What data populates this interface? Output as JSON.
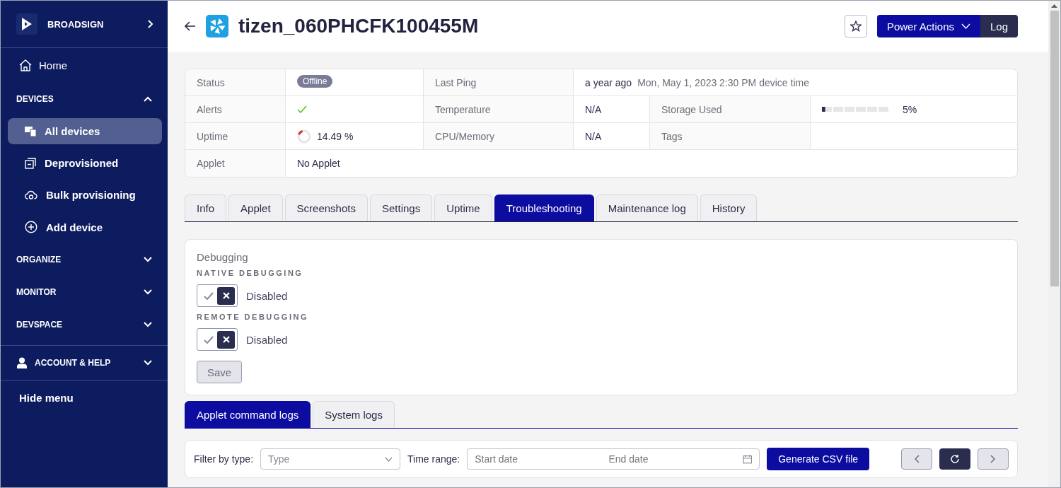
{
  "sidebar": {
    "brand": "BROADSIGN",
    "nav": [
      {
        "kind": "link",
        "label": "Home"
      },
      {
        "kind": "section",
        "label": "DEVICES",
        "expanded": true,
        "children": [
          {
            "label": "All devices",
            "selected": true
          },
          {
            "label": "Deprovisioned",
            "selected": false
          },
          {
            "label": "Bulk provisioning",
            "selected": false
          },
          {
            "label": "Add device",
            "selected": false
          }
        ]
      },
      {
        "kind": "section",
        "label": "ORGANIZE",
        "expanded": false
      },
      {
        "kind": "section",
        "label": "MONITOR",
        "expanded": false
      },
      {
        "kind": "section",
        "label": "DEVSPACE",
        "expanded": false
      }
    ],
    "account": {
      "label": "ACCOUNT & HELP",
      "expanded": false
    },
    "hide_menu": "Hide menu"
  },
  "header": {
    "title": "tizen_060PHCFK100455M",
    "power_actions": "Power Actions",
    "log": "Log"
  },
  "info": {
    "status": {
      "label": "Status",
      "value": "Offline"
    },
    "last_ping": {
      "label": "Last Ping",
      "relative": "a year ago",
      "absolute": "Mon, May 1, 2023 2:30 PM device time"
    },
    "alerts": {
      "label": "Alerts",
      "ok": true
    },
    "temperature": {
      "label": "Temperature",
      "value": "N/A"
    },
    "storage_used": {
      "label": "Storage Used",
      "level": 0.05,
      "reading": "5%"
    },
    "uptime": {
      "label": "Uptime",
      "level": 0.1449,
      "reading": "14.49 %"
    },
    "cpu_memory": {
      "label": "CPU/Memory",
      "value": "N/A"
    },
    "tags": {
      "label": "Tags"
    },
    "applet": {
      "label": "Applet",
      "value": "No Applet"
    }
  },
  "tabs": [
    {
      "label": "Info",
      "selected": false
    },
    {
      "label": "Applet",
      "selected": false
    },
    {
      "label": "Screenshots",
      "selected": false
    },
    {
      "label": "Settings",
      "selected": false
    },
    {
      "label": "Uptime",
      "selected": false
    },
    {
      "label": "Troubleshooting",
      "selected": true
    },
    {
      "label": "Maintenance log",
      "selected": false
    },
    {
      "label": "History",
      "selected": false
    }
  ],
  "debugging": {
    "title": "Debugging",
    "settings": [
      {
        "label": "NATIVE DEBUGGING",
        "options": [
          {
            "selected": false
          },
          {
            "selected": true
          }
        ],
        "state_label": "Disabled"
      },
      {
        "label": "REMOTE DEBUGGING",
        "options": [
          {
            "selected": false
          },
          {
            "selected": true
          }
        ],
        "state_label": "Disabled"
      }
    ],
    "save": {
      "label": "Save",
      "disabled": true
    }
  },
  "log_tabs": [
    {
      "label": "Applet command logs",
      "selected": true
    },
    {
      "label": "System logs",
      "selected": false
    }
  ],
  "filters": {
    "type_label": "Filter by type:",
    "type_placeholder": "Type",
    "time_label": "Time range:",
    "start_placeholder": "Start date",
    "end_placeholder": "End date",
    "generate": "Generate CSV file"
  }
}
